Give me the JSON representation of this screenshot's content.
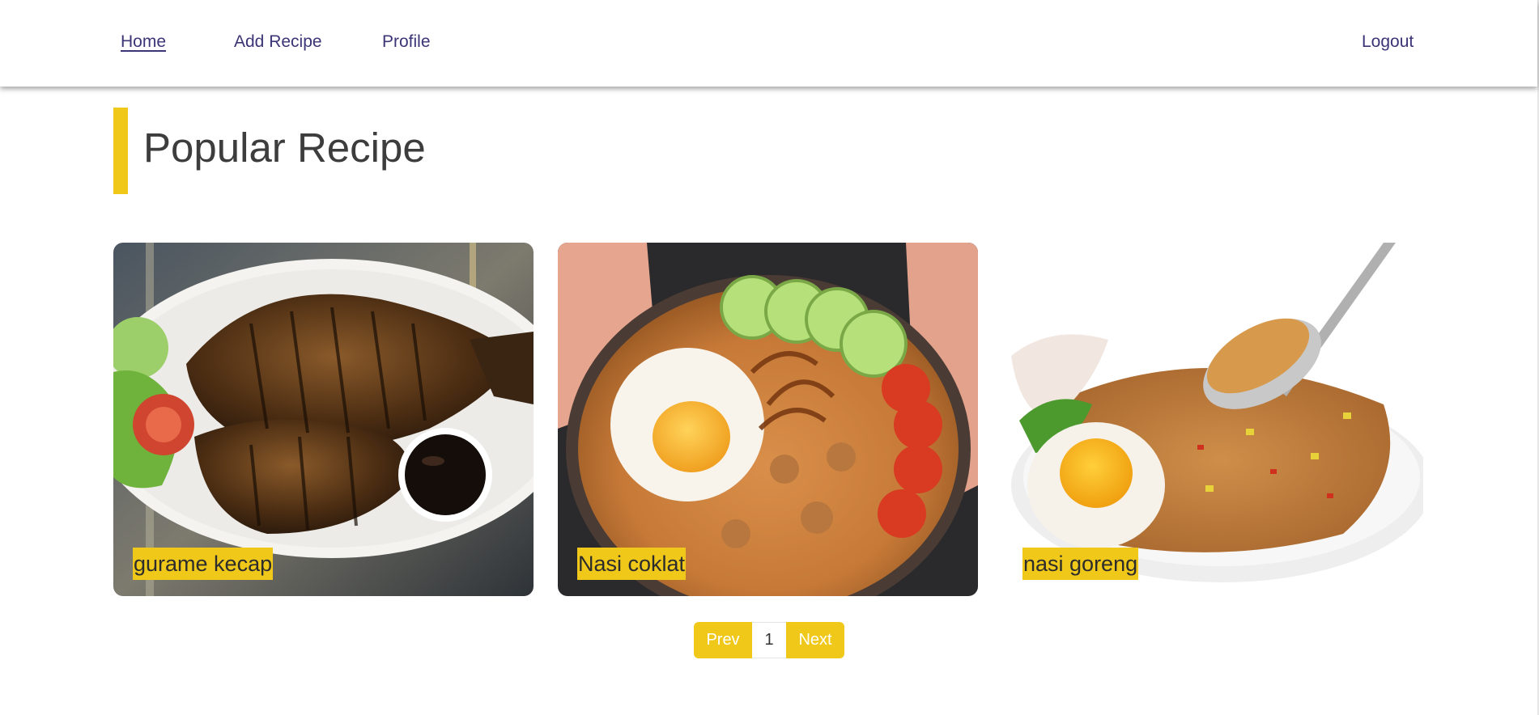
{
  "nav": {
    "home": "Home",
    "add_recipe": "Add Recipe",
    "profile": "Profile",
    "logout": "Logout"
  },
  "page": {
    "title": "Popular Recipe"
  },
  "recipes": [
    {
      "name": "gurame kecap",
      "image": "grilled-fish-image"
    },
    {
      "name": "Nasi coklat",
      "image": "fried-rice-with-egg-image"
    },
    {
      "name": "nasi goreng",
      "image": "nasi-goreng-plate-image"
    }
  ],
  "pagination": {
    "prev": "Prev",
    "current_page": "1",
    "next": "Next"
  },
  "colors": {
    "accent": "#f0c81a",
    "nav_text": "#3b3476",
    "title_text": "#3d3d3d"
  }
}
